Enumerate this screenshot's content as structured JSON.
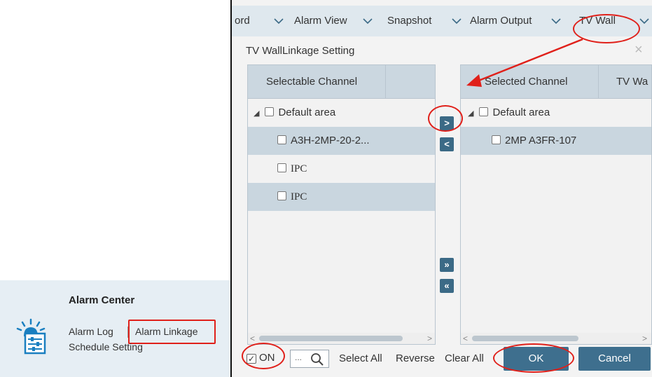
{
  "alarm_center": {
    "title": "Alarm Center",
    "links": {
      "alarm_log": "Alarm Log",
      "alarm_linkage": "Alarm Linkage",
      "schedule_setting": "Schedule Setting"
    }
  },
  "tabs": [
    {
      "label": "ord"
    },
    {
      "label": "Alarm View"
    },
    {
      "label": "Snapshot"
    },
    {
      "label": "Alarm Output"
    },
    {
      "label": "TV Wall"
    }
  ],
  "dialog": {
    "title": "TV WallLinkage Setting",
    "close_symbol": "×",
    "left_panel": {
      "header": "Selectable Channel",
      "group": "Default area",
      "items": [
        "A3H-2MP-20-2...",
        "IPC",
        "IPC"
      ]
    },
    "right_panel": {
      "headers": [
        "Selected Channel",
        "TV Wa"
      ],
      "group": "Default area",
      "items": [
        "2MP A3FR-107"
      ]
    },
    "transfer_buttons": {
      "add": ">",
      "remove": "<",
      "add_all": "»",
      "remove_all": "«"
    },
    "footer": {
      "on_label": "ON",
      "on_checked": true,
      "search_dots": "...",
      "select_all": "Select All",
      "reverse": "Reverse",
      "clear_all": "Clear All",
      "ok": "OK",
      "cancel": "Cancel"
    }
  },
  "colors": {
    "annotation_red": "#e0201a",
    "button_blue": "#3e6f8e",
    "header_blue": "#cbd7e0"
  }
}
